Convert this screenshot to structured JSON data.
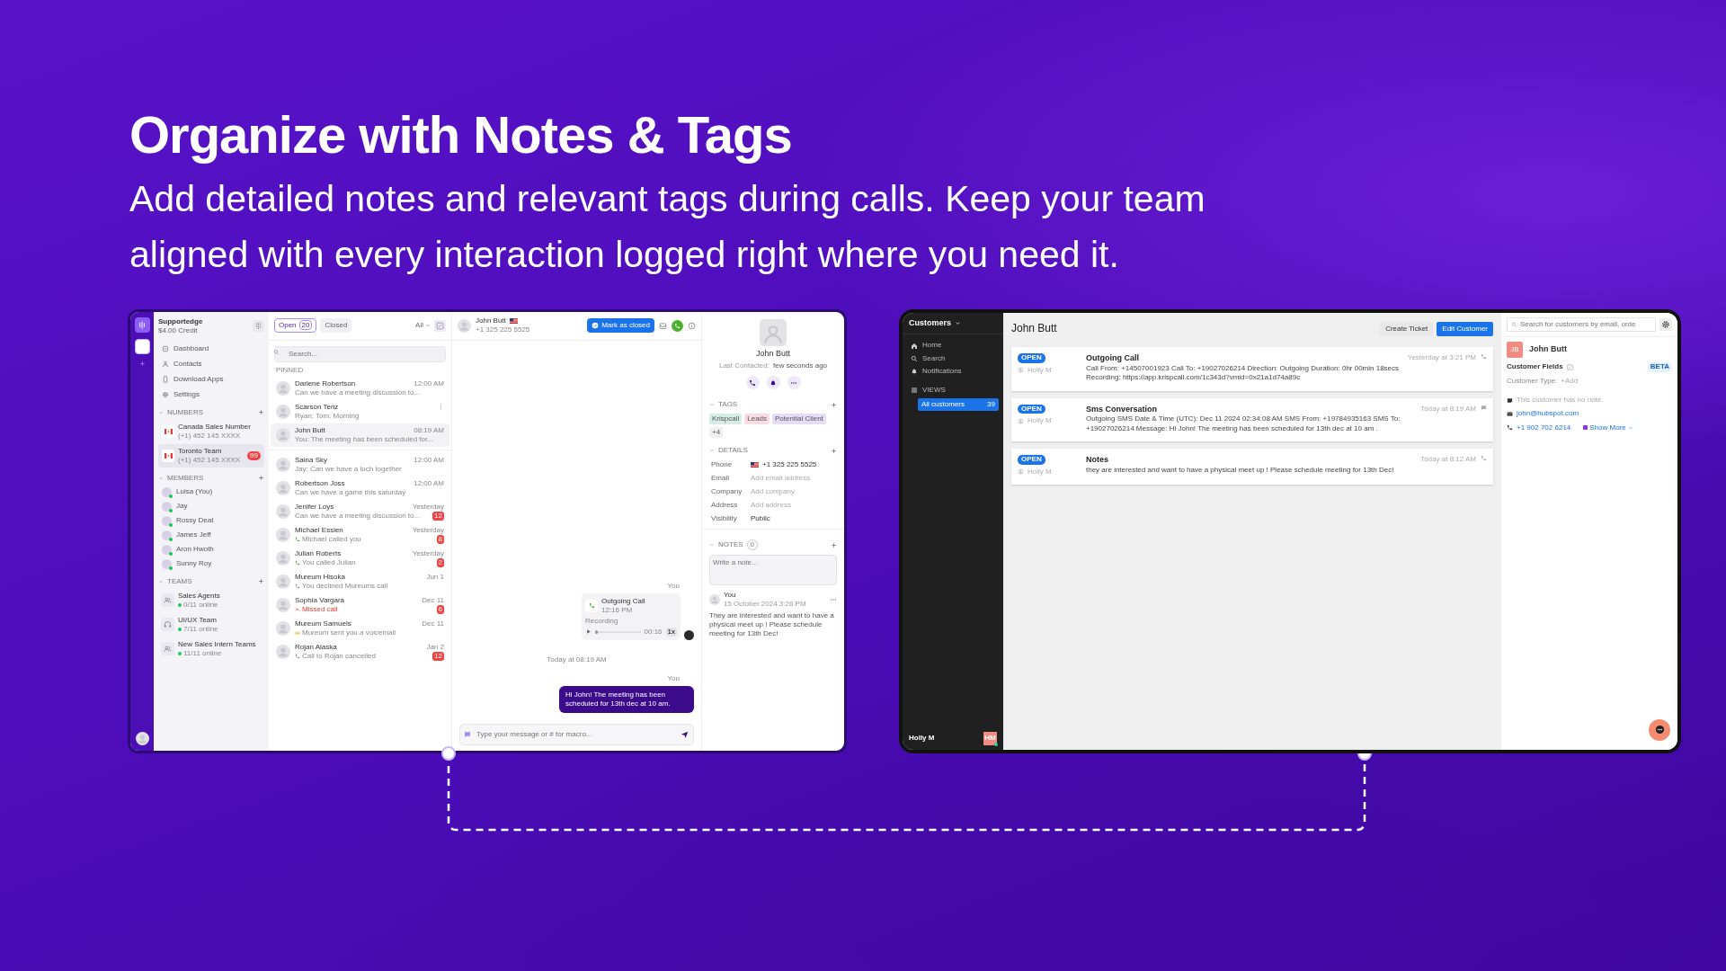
{
  "headline": "Organize with Notes & Tags",
  "subheadline": "Add detailed notes and relevant tags during calls. Keep your team aligned with every interaction logged right where you need it.",
  "left_app": {
    "workspace": {
      "name": "Supportedge",
      "credit": "$4.00 Credit"
    },
    "nav": [
      "Dashboard",
      "Contacts",
      "Download Apps",
      "Settings"
    ],
    "numbers": {
      "title": "NUMBERS",
      "items": [
        {
          "name": "Canada Sales Number",
          "number": "(+1) 452 145 XXXX",
          "selected": false
        },
        {
          "name": "Toronto Team",
          "number": "(+1) 452 145 XXXX",
          "badge": "99",
          "selected": true
        }
      ]
    },
    "members": {
      "title": "MEMBERS",
      "items": [
        {
          "name": "Luisa (You)",
          "online": true
        },
        {
          "name": "Jay",
          "online": true
        },
        {
          "name": "Rossy Deat",
          "online": true
        },
        {
          "name": "James Jeff",
          "online": true
        },
        {
          "name": "Aron Hwoth",
          "online": true
        },
        {
          "name": "Sunny Roy",
          "online": true
        }
      ]
    },
    "teams": {
      "title": "TEAMS",
      "items": [
        {
          "name": "Sales Agents",
          "status": "0/11 online"
        },
        {
          "name": "UI/UX Team",
          "status": "7/11 online"
        },
        {
          "name": "New Sales Intern Teams",
          "status": "11/11 online"
        }
      ]
    },
    "filter_tabs": [
      {
        "label": "Open",
        "count": "20",
        "selected": true
      },
      {
        "label": "Closed",
        "selected": false
      }
    ],
    "filter_dropdown": "All",
    "search": {
      "placeholder": "Search..."
    },
    "pinned_label": "PINNED",
    "pinned_conversations": [
      {
        "name": "Darlene Robertson",
        "time": "12:00 AM",
        "preview": "Can we have a meeting discussion to...",
        "selected": false
      },
      {
        "name": "Scarson Tenz",
        "preview": "Ryan: Tom. Morning",
        "selected": false
      },
      {
        "name": "John Butt",
        "time": "08:19 AM",
        "preview": "You: The meeting has been scheduled for...",
        "selected": true
      }
    ],
    "conversations": [
      {
        "name": "Saina Sky",
        "time": "12:00 AM",
        "preview": "Jay: Can we have a luch together",
        "selected": false
      },
      {
        "name": "Robertson Joss",
        "time": "12:00 AM",
        "preview": "Can we have a game this saturday",
        "selected": false
      },
      {
        "name": "Jenifer Loys",
        "time": "Yesterday",
        "preview": "Can we have a meeting discussion to...",
        "badge": "12",
        "selected": false
      },
      {
        "name": "Michael Essien",
        "time": "Yesterday",
        "preview": "Michael called you",
        "badge": "8",
        "kind": "incoming_call",
        "selected": false
      },
      {
        "name": "Julian Roberts",
        "time": "Yesterday",
        "preview": "You called Julian",
        "badge": "2",
        "kind": "outgoing_call",
        "selected": false
      },
      {
        "name": "Mureum Hisoka",
        "time": "Jun 1",
        "preview": "You declined Mureums call",
        "kind": "declined_call",
        "selected": false
      },
      {
        "name": "Sophia Vargara",
        "time": "Dec 11",
        "preview": "Missed call",
        "badge": "6",
        "kind": "missed_call",
        "selected": false
      },
      {
        "name": "Mureum Samuels",
        "time": "Dec 11",
        "preview": "Mureum sent you a voicemail",
        "kind": "voicemail",
        "selected": false
      },
      {
        "name": "Rojan Alaska",
        "time": "Jan 2",
        "preview": "Call to Rojan cancelled",
        "badge": "12",
        "kind": "cancelled_call",
        "selected": false
      }
    ],
    "chat": {
      "contact": "John Butt",
      "phone": "+1 325 225 5525",
      "close_button": "Mark as closed",
      "call_sender": "You",
      "call": {
        "title": "Outgoing Call",
        "time": "12:16 PM",
        "recording_label": "Recording",
        "duration": "00:16",
        "speed": "1x",
        "level": 0.05
      },
      "timestamp": "Today at 08:19 AM",
      "message_sender": "You",
      "message": "Hi John!  The meeting has been scheduled for 13th dec at 10 am.",
      "composer": {
        "placeholder": "Type your message or # for macro..."
      }
    },
    "contact": {
      "name": "John Butt",
      "last_contacted_label": "Last Contacted:",
      "last_contacted": "few seconds ago",
      "tags_title": "TAGS",
      "tags": [
        {
          "label": "Krispcall",
          "color": "#d5ede6"
        },
        {
          "label": "Leads",
          "color": "#f9dbe3"
        },
        {
          "label": "Potential Client",
          "color": "#e5dcf7"
        }
      ],
      "more_tags": "+4",
      "details_title": "DETAILS",
      "details": [
        {
          "label": "Phone",
          "value": "+1 325 225 5525",
          "kind": "phone"
        },
        {
          "label": "Email",
          "placeholder": "Add email address",
          "kind": "empty"
        },
        {
          "label": "Company",
          "placeholder": "Add company",
          "kind": "empty"
        },
        {
          "label": "Address",
          "placeholder": "Add address",
          "kind": "empty"
        },
        {
          "label": "Visibility",
          "value": "Public",
          "kind": "text"
        }
      ],
      "notes_title": "NOTES",
      "notes_count": "0",
      "note_field": {
        "placeholder": "Write a note..."
      },
      "note": {
        "author": "You",
        "date": "15 October 2024 3:26 PM",
        "text": "They are interested and want to have a physical meet up ! Please schedule meeting for 13th Dec!"
      }
    }
  },
  "right_app": {
    "sidebar": {
      "title": "Customers",
      "nav": [
        "Home",
        "Search",
        "Notifications"
      ],
      "views_title": "VIEWS",
      "views": [
        {
          "label": "All customers",
          "count": "39",
          "selected": true
        }
      ],
      "user": "Holly M",
      "user_initials": "HM"
    },
    "customer": "John Butt",
    "buttons": [
      "Create Ticket",
      "Edit Customer"
    ],
    "tickets": [
      {
        "status": "OPEN",
        "agent": "Holly M",
        "title": "Outgoing Call",
        "body": "Call From: +14507001923 Call To: +19027026214 Direction: Outgoing Duration: 0hr 00min 18secs Recording: https://app.krispcall.com/1c343d?vmid=0x21a1d74a89c",
        "time": "Yesterday at 3:21 PM",
        "kind": "call"
      },
      {
        "status": "OPEN",
        "agent": "Holly M",
        "title": "Sms Conversation",
        "body": "Outgoing SMS Date & Time (UTC): Dec 11 2024 02:34:08 AM SMS From: +19784935163 SMS To: +19027026214 Message: Hi John! The meeting has been scheduled for 13th dec at 10 am .",
        "time": "Today at 8:19 AM",
        "kind": "sms"
      },
      {
        "status": "OPEN",
        "agent": "Holly M",
        "title": "Notes",
        "body": "they are interested and want to have a physical meet up ! Please schedule meeting for 13th Dec!",
        "time": "Today at 8:12 AM",
        "kind": "call"
      }
    ],
    "panel": {
      "search": {
        "placeholder": "Search for customers by email, orde"
      },
      "initials": "JB",
      "name": "John Butt",
      "fields_title": "Customer Fields",
      "beta": "BETA",
      "type_label": "Customer Type:",
      "type_add": "+Add",
      "note": "This customer has no note.",
      "email": "john@hubspot.com",
      "phone": "+1 902 702 6214",
      "show_more": "Show More"
    }
  }
}
